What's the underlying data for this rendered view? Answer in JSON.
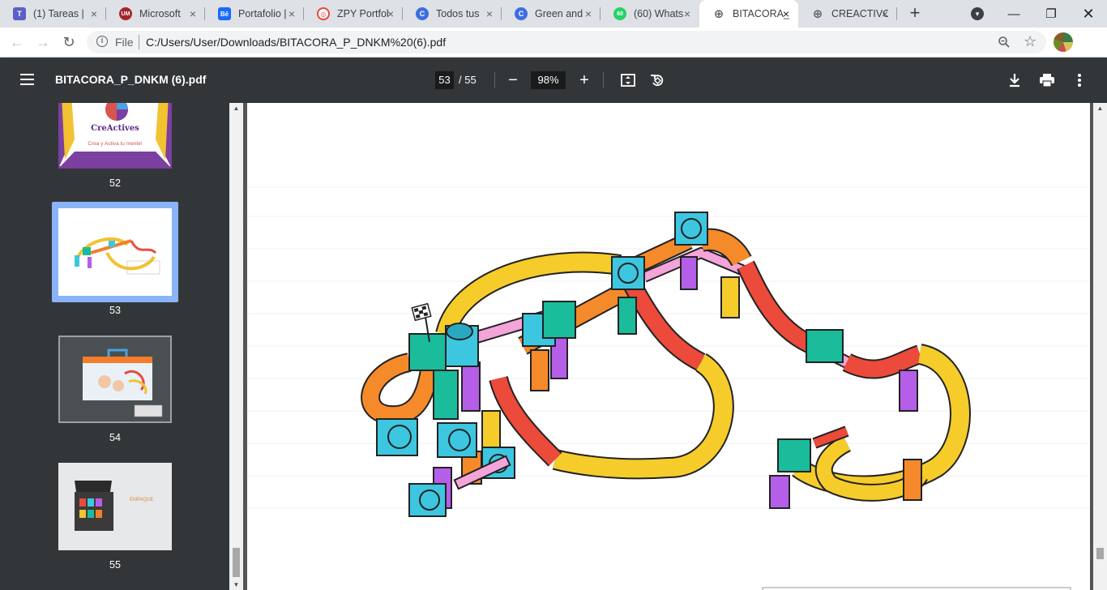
{
  "browser": {
    "tabs": [
      {
        "title": "(1) Tareas |",
        "fav_color": "#5b5fc7",
        "fav_glyph": "T"
      },
      {
        "title": "Microsoft",
        "fav_color": "#a4262c",
        "fav_glyph": "UM"
      },
      {
        "title": "Portafolio |",
        "fav_color": "#1769ff",
        "fav_glyph": "Bē"
      },
      {
        "title": "ZPY Portfol",
        "fav_color": "#e8453c",
        "fav_glyph": "◎"
      },
      {
        "title": "Todos tus",
        "fav_color": "#3d6ee0",
        "fav_glyph": "C"
      },
      {
        "title": "Green and",
        "fav_color": "#3d6ee0",
        "fav_glyph": "C"
      },
      {
        "title": "(60) Whats",
        "fav_color": "#25d366",
        "fav_glyph": "60"
      },
      {
        "title": "BITACORA_",
        "fav_color": "#5f6368",
        "fav_glyph": "⊕"
      },
      {
        "title": "CREACTIVO",
        "fav_color": "#5f6368",
        "fav_glyph": "⊕"
      }
    ],
    "active_tab": 7,
    "address": {
      "scheme_label": "File",
      "url": "C:/Users/User/Downloads/BITACORA_P_DNKM%20(6).pdf"
    }
  },
  "pdf": {
    "filename": "BITACORA_P_DNKM (6).pdf",
    "current_page": "53",
    "total_pages": "/ 55",
    "zoom": "98%"
  },
  "thumbnails": [
    {
      "number": "52",
      "selected": false,
      "caption_top": "CreActives",
      "caption_bottom": "Crea y Activa tu mente!"
    },
    {
      "number": "53",
      "selected": true
    },
    {
      "number": "54",
      "selected": false
    },
    {
      "number": "55",
      "selected": false,
      "label": "EMPAQUE"
    }
  ]
}
